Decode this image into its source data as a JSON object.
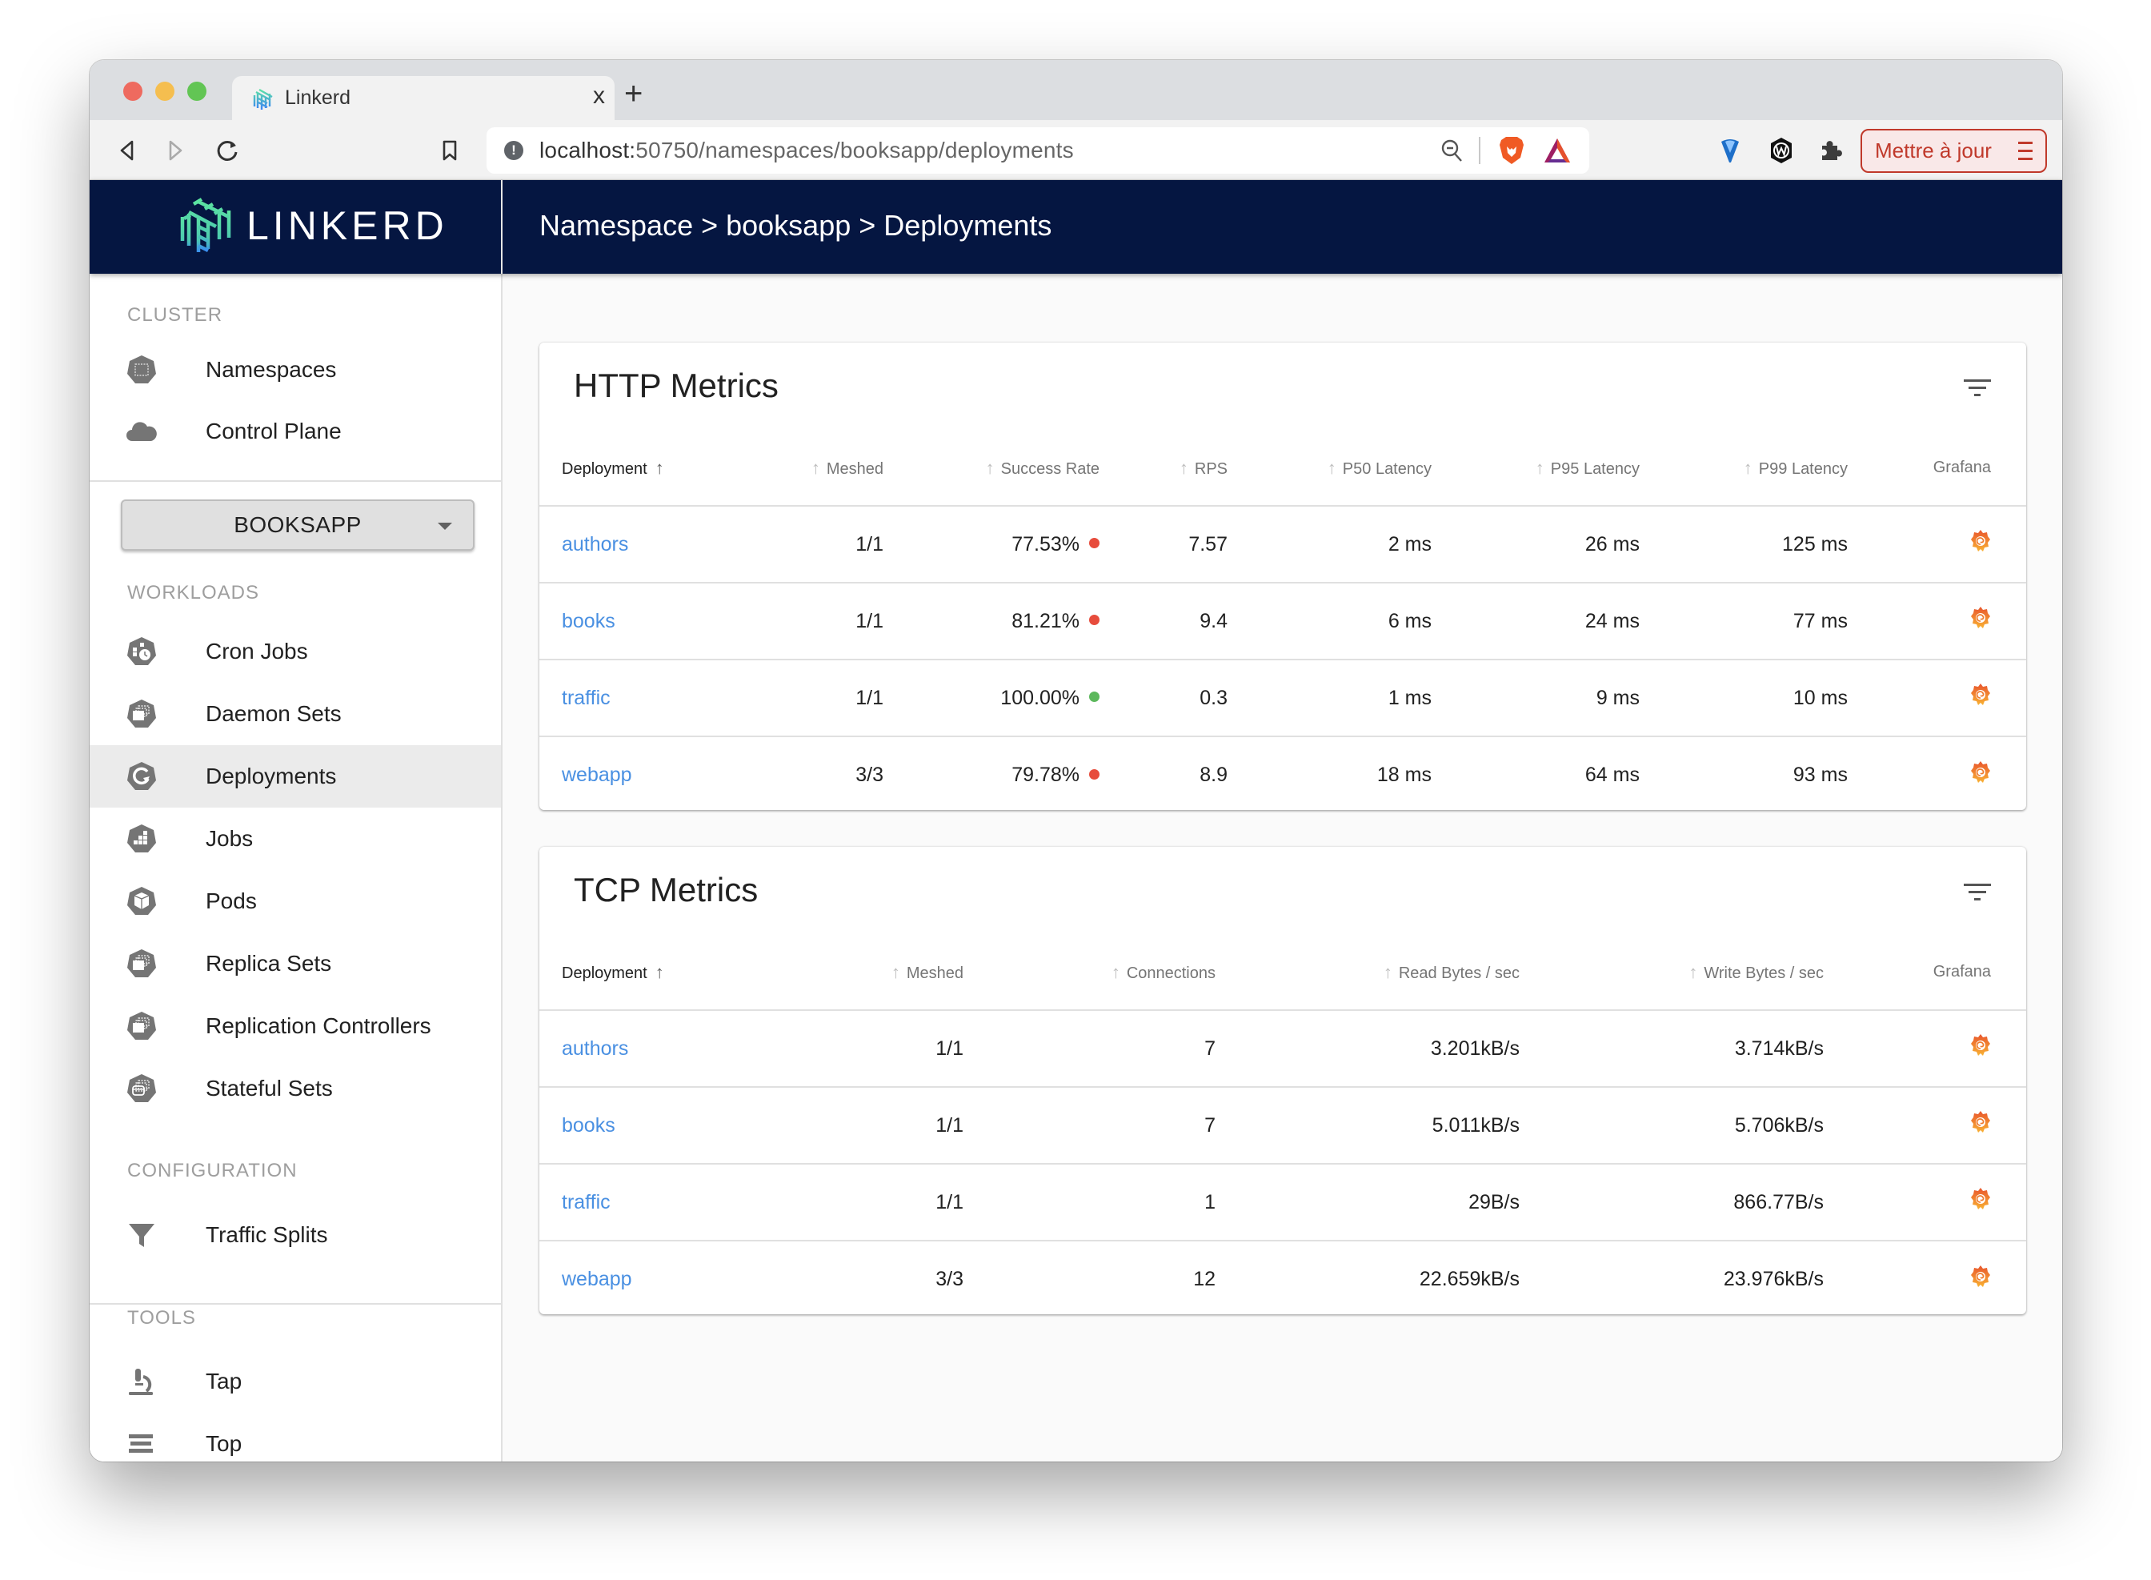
{
  "browser": {
    "tab_title": "Linkerd",
    "tab_close": "x",
    "new_tab": "+",
    "url_host": "localhost:",
    "url_path": "50750/namespaces/booksapp/deployments",
    "update_button": "Mettre à jour",
    "icons": [
      "back-icon",
      "forward-icon",
      "reload-icon",
      "bookmark-icon",
      "site-info-icon",
      "zoom-out-icon",
      "brave-shields-icon",
      "bat-rewards-icon",
      "extension-pin-icon",
      "extension-w-icon",
      "extensions-puzzle-icon",
      "menu-icon"
    ]
  },
  "header": {
    "logo_text": "LINKERD",
    "breadcrumb": "Namespace > booksapp > Deployments"
  },
  "sidebar": {
    "sections": {
      "cluster": "CLUSTER",
      "workloads": "WORKLOADS",
      "configuration": "CONFIGURATION",
      "tools": "TOOLS"
    },
    "cluster_items": [
      {
        "label": "Namespaces",
        "icon": "namespace-icon"
      },
      {
        "label": "Control Plane",
        "icon": "cloud-icon"
      }
    ],
    "namespace_select": "BOOKSAPP",
    "workload_items": [
      {
        "label": "Cron Jobs",
        "icon": "cronjob-icon"
      },
      {
        "label": "Daemon Sets",
        "icon": "daemonset-icon"
      },
      {
        "label": "Deployments",
        "icon": "deployment-icon",
        "active": true
      },
      {
        "label": "Jobs",
        "icon": "job-icon"
      },
      {
        "label": "Pods",
        "icon": "pod-icon"
      },
      {
        "label": "Replica Sets",
        "icon": "replicaset-icon"
      },
      {
        "label": "Replication Controllers",
        "icon": "replication-controller-icon"
      },
      {
        "label": "Stateful Sets",
        "icon": "statefulset-icon"
      }
    ],
    "configuration_items": [
      {
        "label": "Traffic Splits",
        "icon": "filter-funnel-icon"
      }
    ],
    "tool_items": [
      {
        "label": "Tap",
        "icon": "microscope-icon"
      },
      {
        "label": "Top",
        "icon": "list-icon"
      }
    ]
  },
  "http_metrics": {
    "title": "HTTP Metrics",
    "columns": [
      "Deployment",
      "Meshed",
      "Success Rate",
      "RPS",
      "P50 Latency",
      "P95 Latency",
      "P99 Latency",
      "Grafana"
    ],
    "rows": [
      {
        "deployment": "authors",
        "meshed": "1/1",
        "success_rate": "77.53%",
        "status": "bad",
        "rps": "7.57",
        "p50": "2 ms",
        "p95": "26 ms",
        "p99": "125 ms"
      },
      {
        "deployment": "books",
        "meshed": "1/1",
        "success_rate": "81.21%",
        "status": "bad",
        "rps": "9.4",
        "p50": "6 ms",
        "p95": "24 ms",
        "p99": "77 ms"
      },
      {
        "deployment": "traffic",
        "meshed": "1/1",
        "success_rate": "100.00%",
        "status": "good",
        "rps": "0.3",
        "p50": "1 ms",
        "p95": "9 ms",
        "p99": "10 ms"
      },
      {
        "deployment": "webapp",
        "meshed": "3/3",
        "success_rate": "79.78%",
        "status": "bad",
        "rps": "8.9",
        "p50": "18 ms",
        "p95": "64 ms",
        "p99": "93 ms"
      }
    ]
  },
  "tcp_metrics": {
    "title": "TCP Metrics",
    "columns": [
      "Deployment",
      "Meshed",
      "Connections",
      "Read Bytes / sec",
      "Write Bytes / sec",
      "Grafana"
    ],
    "rows": [
      {
        "deployment": "authors",
        "meshed": "1/1",
        "connections": "7",
        "read": "3.201kB/s",
        "write": "3.714kB/s"
      },
      {
        "deployment": "books",
        "meshed": "1/1",
        "connections": "7",
        "read": "5.011kB/s",
        "write": "5.706kB/s"
      },
      {
        "deployment": "traffic",
        "meshed": "1/1",
        "connections": "1",
        "read": "29B/s",
        "write": "866.77B/s"
      },
      {
        "deployment": "webapp",
        "meshed": "3/3",
        "connections": "12",
        "read": "22.659kB/s",
        "write": "23.976kB/s"
      }
    ]
  },
  "colors": {
    "header_bg": "#051641",
    "link": "#4a90e2",
    "status_bad": "#e74c3c",
    "status_good": "#5cb85c",
    "update_button": "#c0392b"
  }
}
